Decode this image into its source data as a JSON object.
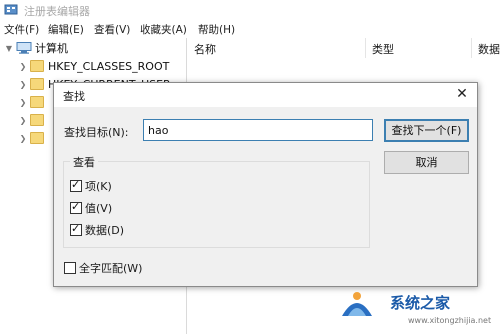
{
  "window": {
    "title": "注册表编辑器",
    "icon": "registry-editor-icon"
  },
  "menu": [
    "文件(F)",
    "编辑(E)",
    "查看(V)",
    "收藏夹(A)",
    "帮助(H)"
  ],
  "tree": {
    "root": "计算机",
    "items": [
      "HKEY_CLASSES_ROOT",
      "HKEY_CURRENT_USER"
    ]
  },
  "list": {
    "columns": [
      "名称",
      "类型",
      "数据"
    ]
  },
  "dialog": {
    "title": "查找",
    "find_label": "查找目标(N):",
    "find_value": "hao",
    "find_next_button": "查找下一个(F)",
    "cancel_button": "取消",
    "look_at_group": "查看",
    "options": [
      {
        "label": "项(K)",
        "checked": true
      },
      {
        "label": "值(V)",
        "checked": true
      },
      {
        "label": "数据(D)",
        "checked": true
      }
    ],
    "match_whole": {
      "label": "全字匹配(W)",
      "checked": false
    }
  },
  "watermark": {
    "text": "系统之家",
    "url": "www.xitongzhijia.net"
  },
  "colors": {
    "accent": "#3c7fb1",
    "dialog_bg": "#f0f0f0",
    "folder": "#f6d87a"
  }
}
